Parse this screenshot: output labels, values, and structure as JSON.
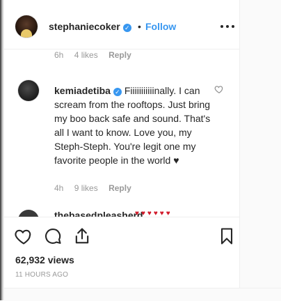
{
  "post": {
    "username": "stephaniecoker",
    "verified": true,
    "separator": "•",
    "follow_label": "Follow",
    "more_icon": "more-horizontal-icon"
  },
  "prev_comment": {
    "time": "6h",
    "likes": "4 likes",
    "reply": "Reply"
  },
  "comment": {
    "username": "kemiadetiba",
    "verified": true,
    "text": "Fiiiiiiiiiiinally. I can scream from the rooftops. Just bring my boo back safe and sound. That's all I want to know. Love you, my Steph-Steph. You're legit one my favorite people in the world ♥",
    "time": "4h",
    "likes": "9 likes",
    "reply": "Reply",
    "like_icon": "heart-outline-icon"
  },
  "next_comment": {
    "username": "thebasedpleasherd",
    "hearts": "♥♥♥♥♥♥"
  },
  "actions": {
    "like_icon": "heart-outline-icon",
    "comment_icon": "speech-bubble-icon",
    "share_icon": "share-upload-icon",
    "save_icon": "bookmark-icon"
  },
  "stats": {
    "views": "62,932 views",
    "timestamp": "11 HOURS AGO"
  },
  "colors": {
    "link_blue": "#3897f0",
    "text": "#262626",
    "muted": "#999999",
    "heart_red": "#d11a2a"
  }
}
